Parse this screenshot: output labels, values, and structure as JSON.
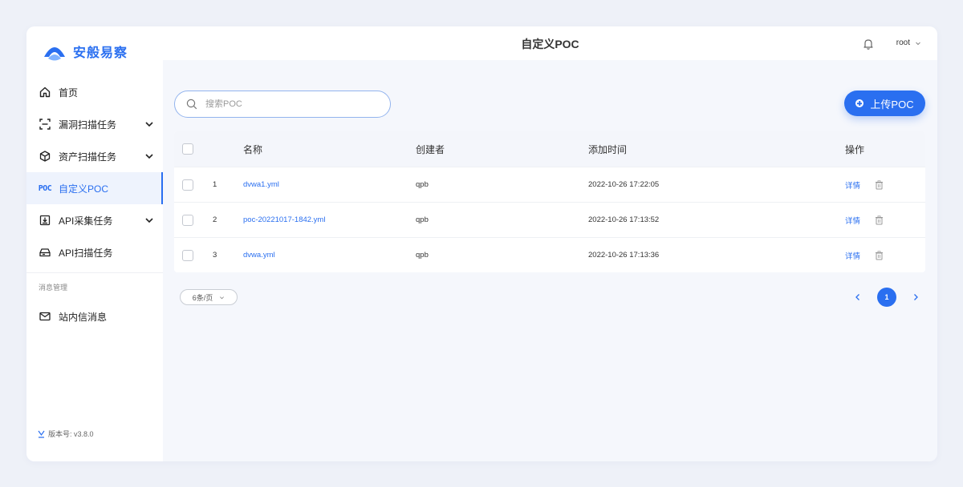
{
  "brand": {
    "name": "安般易察",
    "color": "#2a6ff0"
  },
  "header": {
    "title": "自定义POC",
    "user": "root"
  },
  "sidebar": {
    "items": [
      {
        "label": "首页",
        "icon": "home-icon",
        "expandable": false
      },
      {
        "label": "漏洞扫描任务",
        "icon": "scan-icon",
        "expandable": true
      },
      {
        "label": "资产扫描任务",
        "icon": "box-icon",
        "expandable": true
      },
      {
        "label": "自定义POC",
        "icon": "poc-icon",
        "icon_text": "POC",
        "active": true
      },
      {
        "label": "API采集任务",
        "icon": "download-icon",
        "expandable": true
      },
      {
        "label": "API扫描任务",
        "icon": "drive-icon",
        "expandable": false
      }
    ],
    "group_label": "消息管理",
    "message_item": {
      "label": "站内信消息",
      "icon": "mail-icon"
    },
    "version": "版本号: v3.8.0"
  },
  "search": {
    "placeholder": "搜索POC",
    "value": ""
  },
  "upload_button": {
    "label": "上传POC"
  },
  "table": {
    "headers": [
      "名称",
      "创建者",
      "添加时间",
      "操作"
    ],
    "rows": [
      {
        "index": "1",
        "name": "dvwa1.yml",
        "creator": "qpb",
        "time": "2022-10-26 17:22:05",
        "action": "详情"
      },
      {
        "index": "2",
        "name": "poc-20221017-1842.yml",
        "creator": "qpb",
        "time": "2022-10-26 17:13:52",
        "action": "详情"
      },
      {
        "index": "3",
        "name": "dvwa.yml",
        "creator": "qpb",
        "time": "2022-10-26 17:13:36",
        "action": "详情"
      }
    ]
  },
  "pagination": {
    "page_size": "6条/页",
    "current_page": "1"
  }
}
